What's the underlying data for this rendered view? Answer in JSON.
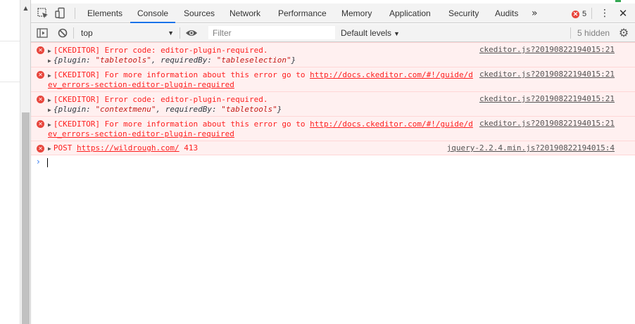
{
  "tabs": [
    {
      "label": "Elements",
      "active": false
    },
    {
      "label": "Console",
      "active": true
    },
    {
      "label": "Sources",
      "active": false
    },
    {
      "label": "Network",
      "active": false
    },
    {
      "label": "Performance",
      "active": false
    },
    {
      "label": "Memory",
      "active": false
    },
    {
      "label": "Application",
      "active": false
    },
    {
      "label": "Security",
      "active": false
    },
    {
      "label": "Audits",
      "active": false
    }
  ],
  "more_tabs_glyph": "»",
  "error_count": "5",
  "toolbar": {
    "context": "top",
    "filter_placeholder": "Filter",
    "levels_label": "Default levels",
    "hidden_label": "5 hidden"
  },
  "messages": [
    {
      "line1": "[CKEDITOR] Error code: editor-plugin-required.",
      "obj_prefix": "{plugin: ",
      "obj_str1": "\"tabletools\"",
      "obj_mid": ", requiredBy: ",
      "obj_str2": "\"tableselection\"",
      "obj_suffix": "}",
      "source": "ckeditor.js?20190822194015:21"
    },
    {
      "line1_text": "[CKEDITOR] For more information about this error go to ",
      "line1_link": "http://docs.ckeditor.com/#!/guide/d",
      "line2_link": "ev_errors-section-editor-plugin-required",
      "source": "ckeditor.js?20190822194015:21"
    },
    {
      "line1": "[CKEDITOR] Error code: editor-plugin-required.",
      "obj_prefix": "{plugin: ",
      "obj_str1": "\"contextmenu\"",
      "obj_mid": ", requiredBy: ",
      "obj_str2": "\"tabletools\"",
      "obj_suffix": "}",
      "source": "ckeditor.js?20190822194015:21"
    },
    {
      "line1_text": "[CKEDITOR] For more information about this error go to ",
      "line1_link": "http://docs.ckeditor.com/#!/guide/d",
      "line2_link": "ev_errors-section-editor-plugin-required",
      "source": "ckeditor.js?20190822194015:21"
    },
    {
      "method": "POST ",
      "url": "https://wildrough.com/",
      "status": " 413",
      "source": "jquery-2.2.4.min.js?20190822194015:4"
    }
  ],
  "prompt_glyph": "›",
  "colors": {
    "error_text": "#fe2020",
    "error_bg": "#fff0f0",
    "active_tab_underline": "#1a73e8",
    "prompt": "#367cf1"
  },
  "icons": [
    "inspect-element-icon",
    "device-toggle-icon",
    "sidebar-toggle-icon",
    "clear-console-icon",
    "eye-icon",
    "settings-gear-icon",
    "error-icon",
    "kebab-menu-icon",
    "close-icon"
  ]
}
